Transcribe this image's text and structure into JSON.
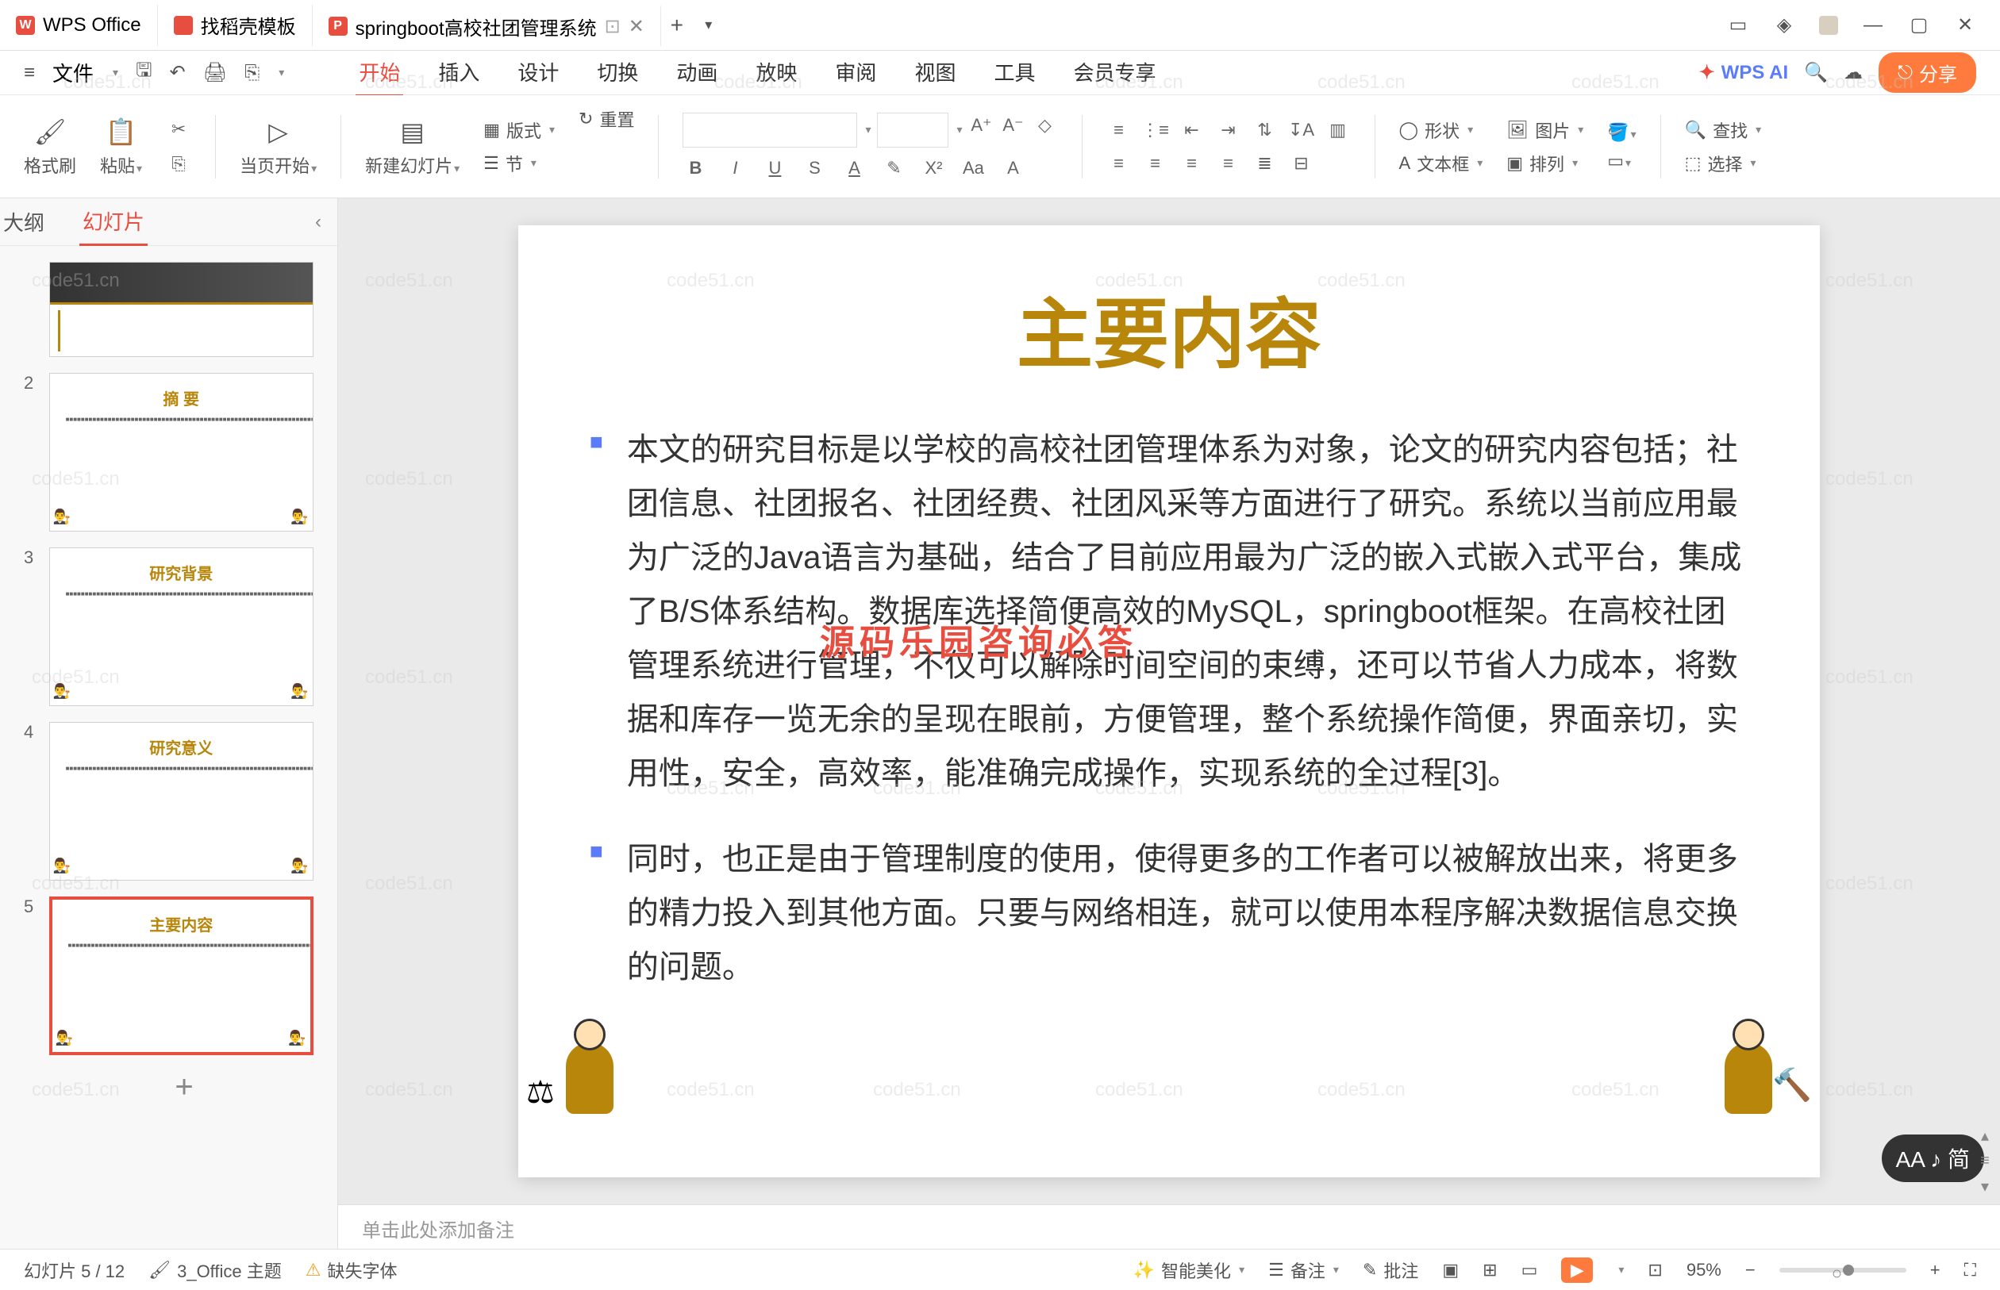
{
  "title_bar": {
    "tabs": [
      {
        "icon": "W",
        "label": "WPS Office"
      },
      {
        "icon": "D",
        "label": "找稻壳模板"
      },
      {
        "icon": "P",
        "label": "springboot高校社团管理系统"
      }
    ],
    "add": "+"
  },
  "menu": {
    "file": "文件",
    "tabs": [
      "开始",
      "插入",
      "设计",
      "切换",
      "动画",
      "放映",
      "审阅",
      "视图",
      "工具",
      "会员专享"
    ],
    "active": "开始",
    "wps_ai": "WPS AI",
    "share": "分享"
  },
  "ribbon": {
    "format_copy": "格式刷",
    "paste": "粘贴",
    "from_slide": "当页开始",
    "new_slide": "新建幻灯片",
    "layout": "版式",
    "section": "节",
    "reset": "重置",
    "shape": "形状",
    "picture": "图片",
    "textbox": "文本框",
    "arrange": "排列",
    "find": "查找",
    "select": "选择"
  },
  "side": {
    "outline": "大纲",
    "slides": "幻灯片",
    "thumbs": [
      {
        "num": "",
        "title": ""
      },
      {
        "num": "2",
        "title": "摘  要"
      },
      {
        "num": "3",
        "title": "研究背景"
      },
      {
        "num": "4",
        "title": "研究意义"
      },
      {
        "num": "5",
        "title": "主要内容"
      }
    ]
  },
  "slide": {
    "title": "主要内容",
    "bullet1": "本文的研究目标是以学校的高校社团管理体系为对象，论文的研究内容包括；社团信息、社团报名、社团经费、社团风采等方面进行了研究。系统以当前应用最为广泛的Java语言为基础，结合了目前应用最为广泛的嵌入式嵌入式平台，集成了B/S体系结构。数据库选择简便高效的MySQL，springboot框架。在高校社团管理系统进行管理，不仅可以解除时间空间的束缚，还可以节省人力成本，将数据和库存一览无余的呈现在眼前，方便管理，整个系统操作简便，界面亲切，实用性，安全，高效率，能准确完成操作，实现系统的全过程[3]。",
    "bullet2": "同时，也正是由于管理制度的使用，使得更多的工作者可以被解放出来，将更多的精力投入到其他方面。只要与网络相连，就可以使用本程序解决数据信息交换的问题。",
    "overlay": "源码乐园咨询必答"
  },
  "notes": {
    "placeholder": "单击此处添加备注"
  },
  "status": {
    "slide_count": "幻灯片 5 / 12",
    "theme": "3_Office 主题",
    "missing_font": "缺失字体",
    "smart_beauty": "智能美化",
    "notes": "备注",
    "comments": "批注",
    "zoom": "95%"
  },
  "aa_pill": "AA ♪ 简",
  "watermark": "code51.cn"
}
